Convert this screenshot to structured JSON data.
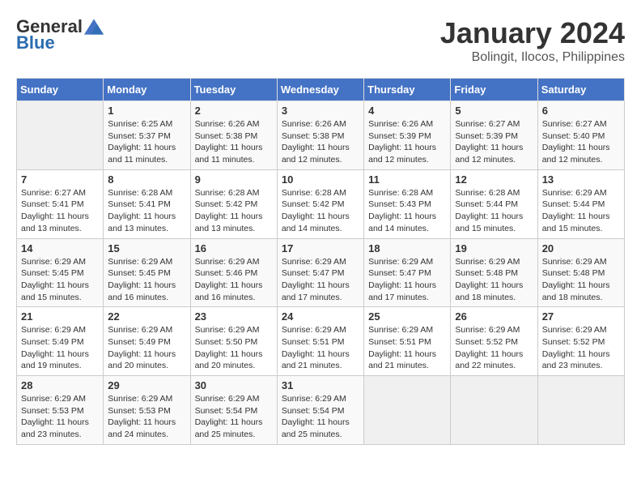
{
  "logo": {
    "general": "General",
    "blue": "Blue"
  },
  "title": "January 2024",
  "subtitle": "Bolingit, Ilocos, Philippines",
  "days_header": [
    "Sunday",
    "Monday",
    "Tuesday",
    "Wednesday",
    "Thursday",
    "Friday",
    "Saturday"
  ],
  "weeks": [
    [
      {
        "day": "",
        "info": ""
      },
      {
        "day": "1",
        "info": "Sunrise: 6:25 AM\nSunset: 5:37 PM\nDaylight: 11 hours\nand 11 minutes."
      },
      {
        "day": "2",
        "info": "Sunrise: 6:26 AM\nSunset: 5:38 PM\nDaylight: 11 hours\nand 11 minutes."
      },
      {
        "day": "3",
        "info": "Sunrise: 6:26 AM\nSunset: 5:38 PM\nDaylight: 11 hours\nand 12 minutes."
      },
      {
        "day": "4",
        "info": "Sunrise: 6:26 AM\nSunset: 5:39 PM\nDaylight: 11 hours\nand 12 minutes."
      },
      {
        "day": "5",
        "info": "Sunrise: 6:27 AM\nSunset: 5:39 PM\nDaylight: 11 hours\nand 12 minutes."
      },
      {
        "day": "6",
        "info": "Sunrise: 6:27 AM\nSunset: 5:40 PM\nDaylight: 11 hours\nand 12 minutes."
      }
    ],
    [
      {
        "day": "7",
        "info": "Sunrise: 6:27 AM\nSunset: 5:41 PM\nDaylight: 11 hours\nand 13 minutes."
      },
      {
        "day": "8",
        "info": "Sunrise: 6:28 AM\nSunset: 5:41 PM\nDaylight: 11 hours\nand 13 minutes."
      },
      {
        "day": "9",
        "info": "Sunrise: 6:28 AM\nSunset: 5:42 PM\nDaylight: 11 hours\nand 13 minutes."
      },
      {
        "day": "10",
        "info": "Sunrise: 6:28 AM\nSunset: 5:42 PM\nDaylight: 11 hours\nand 14 minutes."
      },
      {
        "day": "11",
        "info": "Sunrise: 6:28 AM\nSunset: 5:43 PM\nDaylight: 11 hours\nand 14 minutes."
      },
      {
        "day": "12",
        "info": "Sunrise: 6:28 AM\nSunset: 5:44 PM\nDaylight: 11 hours\nand 15 minutes."
      },
      {
        "day": "13",
        "info": "Sunrise: 6:29 AM\nSunset: 5:44 PM\nDaylight: 11 hours\nand 15 minutes."
      }
    ],
    [
      {
        "day": "14",
        "info": "Sunrise: 6:29 AM\nSunset: 5:45 PM\nDaylight: 11 hours\nand 15 minutes."
      },
      {
        "day": "15",
        "info": "Sunrise: 6:29 AM\nSunset: 5:45 PM\nDaylight: 11 hours\nand 16 minutes."
      },
      {
        "day": "16",
        "info": "Sunrise: 6:29 AM\nSunset: 5:46 PM\nDaylight: 11 hours\nand 16 minutes."
      },
      {
        "day": "17",
        "info": "Sunrise: 6:29 AM\nSunset: 5:47 PM\nDaylight: 11 hours\nand 17 minutes."
      },
      {
        "day": "18",
        "info": "Sunrise: 6:29 AM\nSunset: 5:47 PM\nDaylight: 11 hours\nand 17 minutes."
      },
      {
        "day": "19",
        "info": "Sunrise: 6:29 AM\nSunset: 5:48 PM\nDaylight: 11 hours\nand 18 minutes."
      },
      {
        "day": "20",
        "info": "Sunrise: 6:29 AM\nSunset: 5:48 PM\nDaylight: 11 hours\nand 18 minutes."
      }
    ],
    [
      {
        "day": "21",
        "info": "Sunrise: 6:29 AM\nSunset: 5:49 PM\nDaylight: 11 hours\nand 19 minutes."
      },
      {
        "day": "22",
        "info": "Sunrise: 6:29 AM\nSunset: 5:49 PM\nDaylight: 11 hours\nand 20 minutes."
      },
      {
        "day": "23",
        "info": "Sunrise: 6:29 AM\nSunset: 5:50 PM\nDaylight: 11 hours\nand 20 minutes."
      },
      {
        "day": "24",
        "info": "Sunrise: 6:29 AM\nSunset: 5:51 PM\nDaylight: 11 hours\nand 21 minutes."
      },
      {
        "day": "25",
        "info": "Sunrise: 6:29 AM\nSunset: 5:51 PM\nDaylight: 11 hours\nand 21 minutes."
      },
      {
        "day": "26",
        "info": "Sunrise: 6:29 AM\nSunset: 5:52 PM\nDaylight: 11 hours\nand 22 minutes."
      },
      {
        "day": "27",
        "info": "Sunrise: 6:29 AM\nSunset: 5:52 PM\nDaylight: 11 hours\nand 23 minutes."
      }
    ],
    [
      {
        "day": "28",
        "info": "Sunrise: 6:29 AM\nSunset: 5:53 PM\nDaylight: 11 hours\nand 23 minutes."
      },
      {
        "day": "29",
        "info": "Sunrise: 6:29 AM\nSunset: 5:53 PM\nDaylight: 11 hours\nand 24 minutes."
      },
      {
        "day": "30",
        "info": "Sunrise: 6:29 AM\nSunset: 5:54 PM\nDaylight: 11 hours\nand 25 minutes."
      },
      {
        "day": "31",
        "info": "Sunrise: 6:29 AM\nSunset: 5:54 PM\nDaylight: 11 hours\nand 25 minutes."
      },
      {
        "day": "",
        "info": ""
      },
      {
        "day": "",
        "info": ""
      },
      {
        "day": "",
        "info": ""
      }
    ]
  ]
}
